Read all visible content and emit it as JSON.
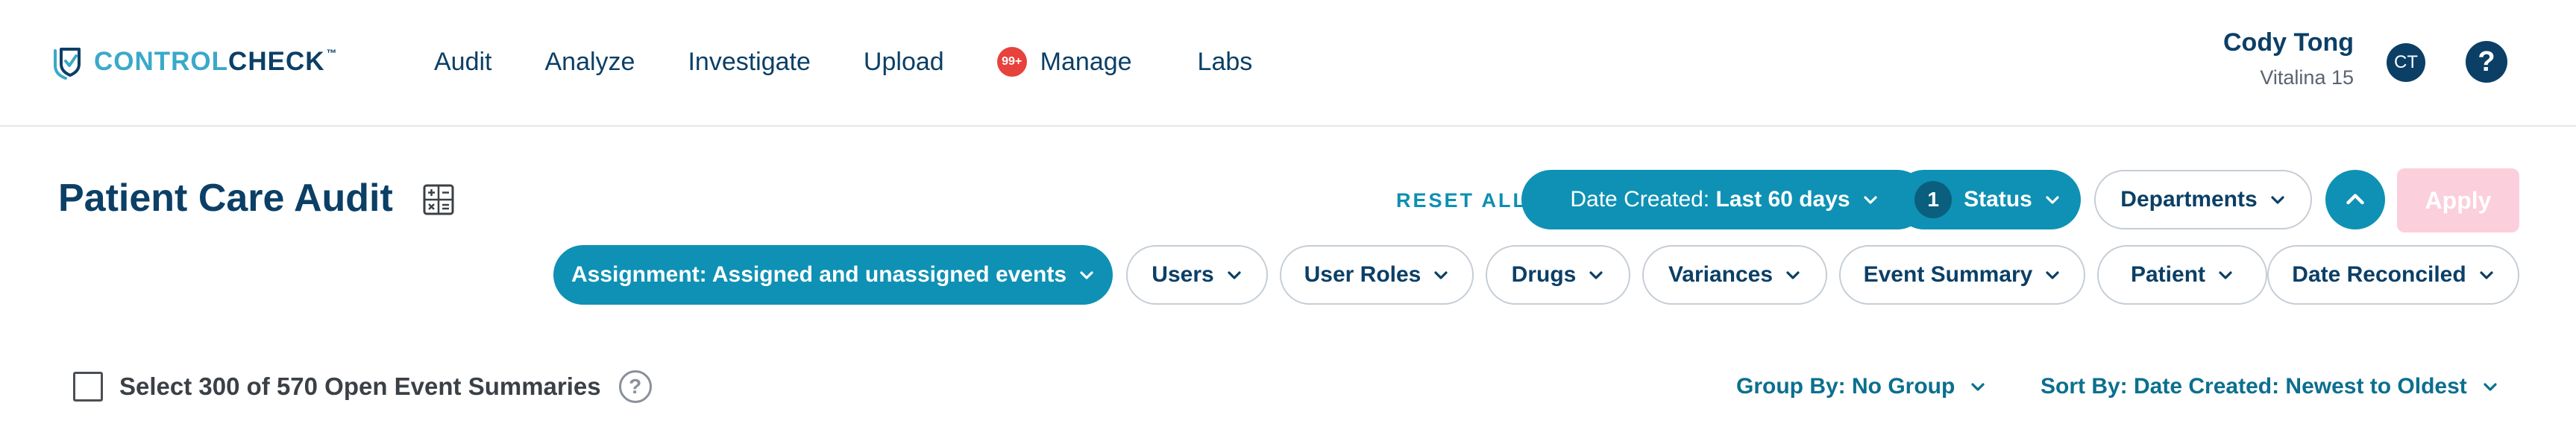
{
  "header": {
    "logo": {
      "part1": "CONTROL",
      "part2": "CHECK",
      "tm": "™"
    },
    "nav": [
      {
        "label": "Audit"
      },
      {
        "label": "Analyze"
      },
      {
        "label": "Investigate"
      },
      {
        "label": "Upload"
      },
      {
        "label": "Manage",
        "badge": "99+"
      },
      {
        "label": "Labs"
      }
    ],
    "user": {
      "name": "Cody Tong",
      "location": "Vitalina 15",
      "initials": "CT"
    },
    "help_label": "?"
  },
  "page": {
    "title": "Patient Care Audit"
  },
  "filters": {
    "reset_label": "RESET ALL",
    "date_created": {
      "prefix": "Date Created:",
      "value": "Last 60 days"
    },
    "status": {
      "count": "1",
      "label": "Status"
    },
    "departments": "Departments",
    "apply": "Apply",
    "assignment": "Assignment: Assigned and unassigned events",
    "users": "Users",
    "user_roles": "User Roles",
    "drugs": "Drugs",
    "variances": "Variances",
    "event_summary": "Event Summary",
    "patient": "Patient",
    "date_reconciled": "Date Reconciled"
  },
  "list_controls": {
    "select_label": "Select 300 of 570 Open Event Summaries",
    "help": "?",
    "group_by": "Group By: No Group",
    "sort_by": "Sort By: Date Created: Newest to Oldest"
  },
  "colors": {
    "primary": "#0e91b4",
    "navy": "#0b3f66",
    "badge_red": "#e8423c",
    "apply_disabled": "#fccfdd"
  }
}
